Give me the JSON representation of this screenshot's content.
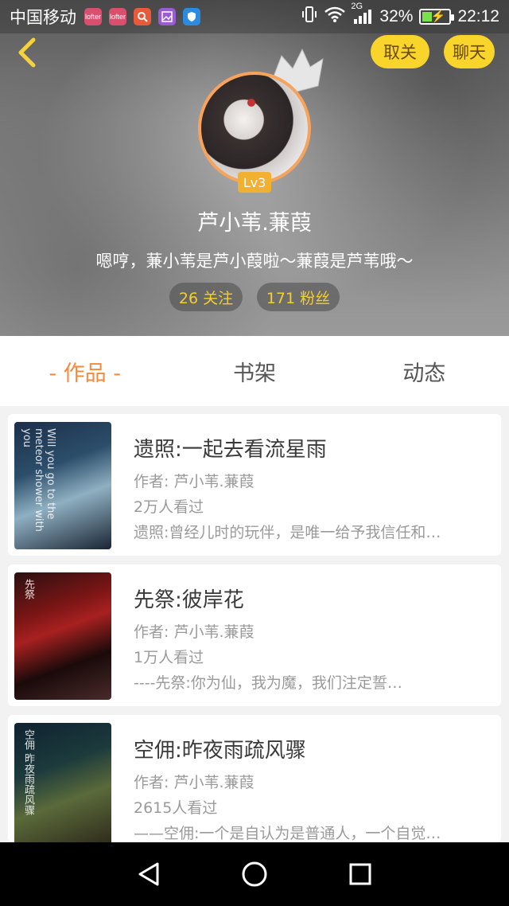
{
  "status_bar": {
    "carrier": "中国移动",
    "network": "2G",
    "battery_percent": "32%",
    "time": "22:12",
    "notification_icons": [
      "app-icon",
      "app-icon",
      "search-app-icon",
      "gallery-icon",
      "shield-icon"
    ]
  },
  "header": {
    "unfollow_label": "取关",
    "chat_label": "聊天",
    "level": "Lv3",
    "nickname": "芦小苇.蒹葭",
    "bio": "嗯哼，蒹小苇是芦小葭啦～蒹葭是芦苇哦～",
    "follow_count": "26 关注",
    "fans_count": "171 粉丝"
  },
  "tabs": [
    {
      "label": "- 作品 -"
    },
    {
      "label": "书架"
    },
    {
      "label": "动态"
    }
  ],
  "works": [
    {
      "title": "遗照:一起去看流星雨",
      "author": "作者: 芦小苇.蒹葭",
      "views": "2万人看过",
      "summary": "遗照:曾经儿时的玩伴，是唯一给予我信任和…",
      "cover_text": "Will you go to the meteor shower with you"
    },
    {
      "title": "先祭:彼岸花",
      "author": "作者: 芦小苇.蒹葭",
      "views": "1万人看过",
      "summary": "----先祭:你为仙，我为魔，我们注定誓…",
      "cover_text": "先祭"
    },
    {
      "title": "空佣:昨夜雨疏风骤",
      "author": "作者: 芦小苇.蒹葭",
      "views": "2615人看过",
      "summary": "——空佣:一个是自认为是普通人，一个自觉…",
      "cover_text": "空佣 昨夜雨疏风骤"
    }
  ],
  "colors": {
    "accent": "#f38a3c",
    "pill": "#f9d42b",
    "stat_text": "#f6cf2a",
    "level_badge": "#f2b030"
  }
}
